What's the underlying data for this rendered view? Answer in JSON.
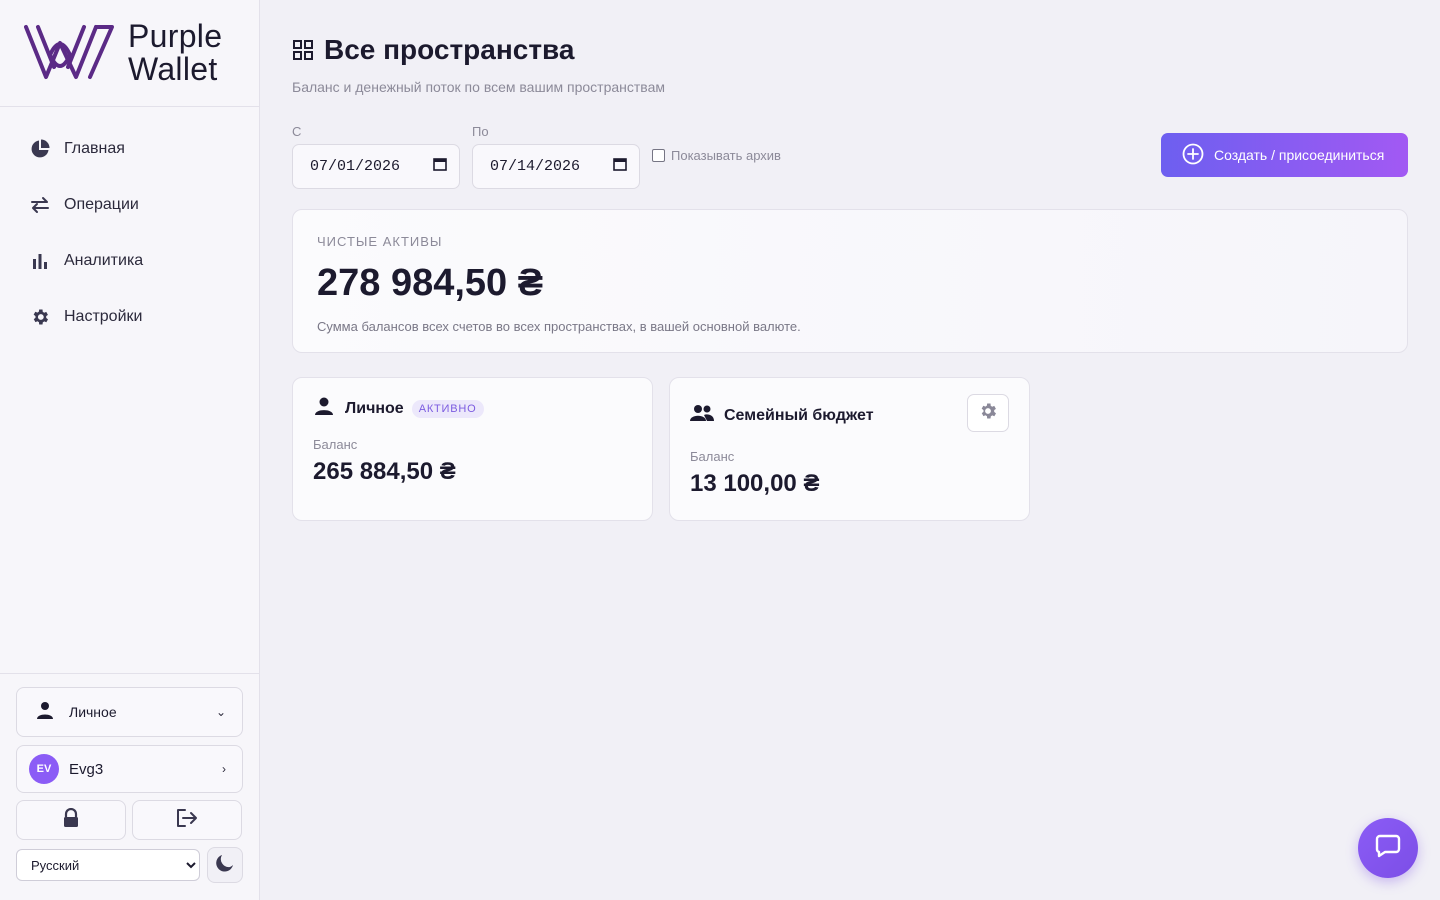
{
  "brand": {
    "name_line1": "Purple",
    "name_line2": "Wallet",
    "logo_icon": "purple-wallet-logo"
  },
  "sidebar": {
    "items": [
      {
        "label": "Главная",
        "icon": "pie-chart-icon"
      },
      {
        "label": "Операции",
        "icon": "swap-arrows-icon"
      },
      {
        "label": "Аналитика",
        "icon": "bar-chart-icon"
      },
      {
        "label": "Настройки",
        "icon": "gear-icon"
      }
    ],
    "space_switcher": {
      "label": "Личное",
      "icon": "user-icon"
    },
    "user": {
      "initials": "EV",
      "name": "Evg3"
    },
    "language": {
      "selected": "Русский"
    }
  },
  "header": {
    "title": "Все пространства",
    "subtitle": "Баланс и денежный поток по всем вашим пространствам"
  },
  "filters": {
    "from_label": "С",
    "from_value": "07/01/2026",
    "to_label": "По",
    "to_value": "07/14/2026",
    "archive_label": "Показывать архив",
    "archive_checked": false
  },
  "create_button": {
    "label": "Создать / присоединиться"
  },
  "net_assets": {
    "label": "ЧИСТЫЕ АКТИВЫ",
    "value": "278 984,50 ₴",
    "description": "Сумма балансов всех счетов во всех пространствах, в вашей основной валюте."
  },
  "spaces": [
    {
      "name": "Личное",
      "badge": "АКТИВНО",
      "balance_label": "Баланс",
      "balance": "265 884,50 ₴",
      "icon": "user-icon"
    },
    {
      "name": "Семейный бюджет",
      "balance_label": "Баланс",
      "balance": "13 100,00 ₴",
      "icon": "users-icon"
    }
  ],
  "colors": {
    "accent": "#8b5cf6",
    "accent_gradient_start": "#6d5ff0",
    "accent_gradient_end": "#a259f3",
    "logo": "#5b2a86"
  }
}
